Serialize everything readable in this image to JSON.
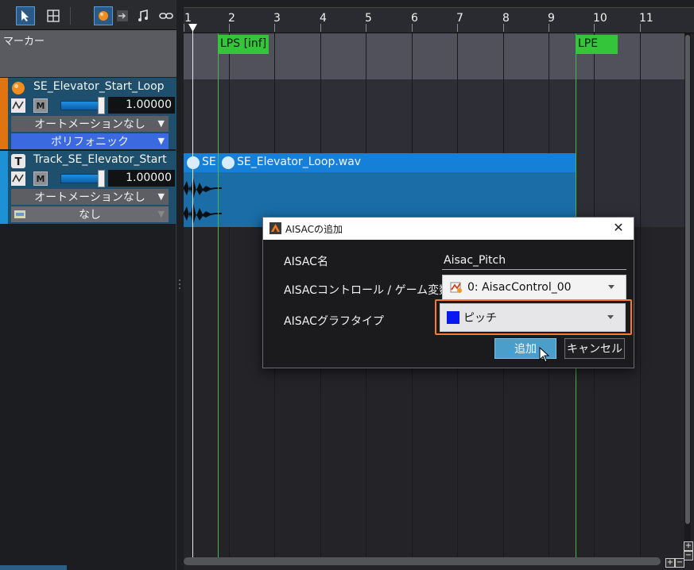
{
  "marker_lane_label": "マーカー",
  "ruler": {
    "numbers": [
      "1",
      "2",
      "3",
      "4",
      "5",
      "6",
      "7",
      "8",
      "9",
      "10",
      "11"
    ]
  },
  "markers": {
    "loop_start": "LPS [inf]",
    "loop_end": "LPE"
  },
  "tracks": [
    {
      "name": "SE_Elevator_Start_Loop",
      "mute": "M",
      "volume": "1.00000",
      "automation": "オートメーションなし",
      "mode": "ポリフォニック"
    },
    {
      "name": "Track_SE_Elevator_Start",
      "mute": "M",
      "volume": "1.00000",
      "automation": "オートメーションなし",
      "mode": "なし"
    }
  ],
  "waveforms": {
    "clip_short": "SE",
    "clip_loop": "SE_Elevator_Loop.wav"
  },
  "dialog": {
    "title": "AISACの追加",
    "name_label": "AISAC名",
    "name_value": "Aisac_Pitch",
    "control_label": "AISACコントロール / ゲーム変数",
    "control_value": "0: AisacControl_00",
    "graph_label": "AISACグラフタイプ",
    "graph_value": "ピッチ",
    "graph_color": "#0a18f0",
    "add_label": "追加",
    "cancel_label": "キャンセル"
  },
  "colors": {
    "marker_green": "#35c53b",
    "selection_blue": "#1680d8",
    "highlight_orange": "#ff7a2e"
  }
}
